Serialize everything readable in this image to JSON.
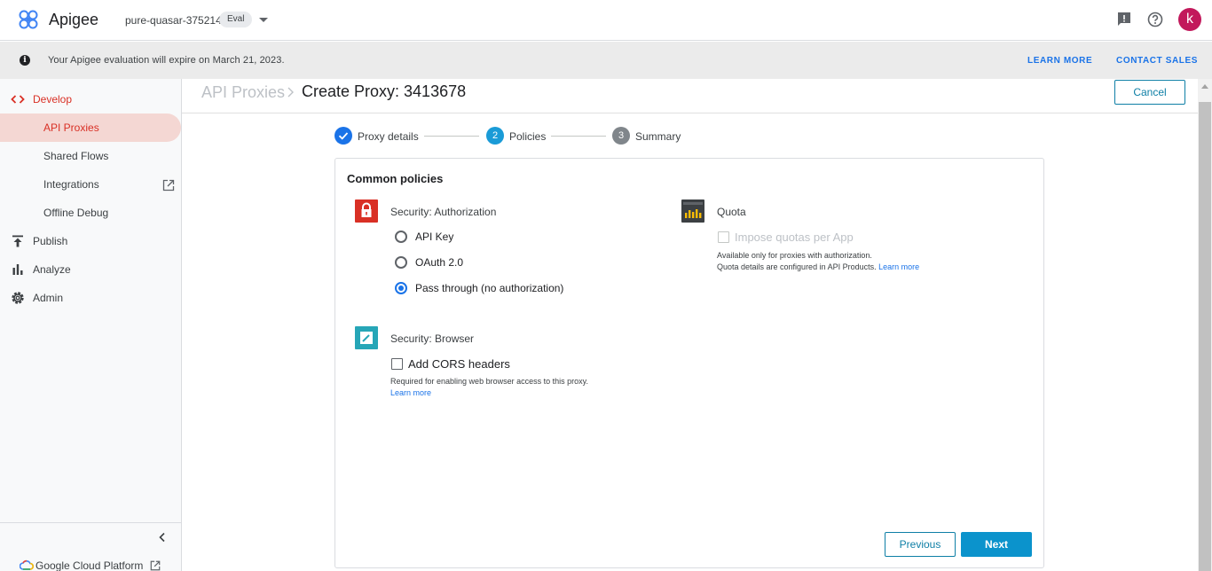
{
  "topbar": {
    "app_name": "Apigee",
    "project_name": "pure-quasar-375214",
    "project_badge": "Eval",
    "icons": [
      "apigee-logo-icon",
      "feedback-icon",
      "help-icon"
    ],
    "avatar_letter": "k",
    "avatar_color": "#c2185b"
  },
  "banner": {
    "message": "Your Apigee evaluation will expire on March 21, 2023.",
    "learn_more": "LEARN MORE",
    "contact_sales": "CONTACT SALES"
  },
  "sidebar": {
    "items": [
      {
        "label": "Develop",
        "icon": "code-icon",
        "state": "active-parent"
      },
      {
        "label": "API Proxies",
        "icon": "",
        "state": "selected"
      },
      {
        "label": "Shared Flows",
        "icon": "",
        "state": ""
      },
      {
        "label": "Integrations",
        "icon": "open-in-new-icon",
        "state": ""
      },
      {
        "label": "Offline Debug",
        "icon": "",
        "state": ""
      },
      {
        "label": "Publish",
        "icon": "publish-icon",
        "state": ""
      },
      {
        "label": "Analyze",
        "icon": "bar-chart-icon",
        "state": ""
      },
      {
        "label": "Admin",
        "icon": "gear-icon",
        "state": ""
      }
    ],
    "footer_label": "Google Cloud Platform"
  },
  "header": {
    "breadcrumb": "API Proxies",
    "title": "Create Proxy: 3413678",
    "cancel_label": "Cancel"
  },
  "stepper": {
    "steps": [
      {
        "number": "1",
        "label": "Proxy details",
        "state": "done"
      },
      {
        "number": "2",
        "label": "Policies",
        "state": "current"
      },
      {
        "number": "3",
        "label": "Summary",
        "state": "todo"
      }
    ]
  },
  "card": {
    "title": "Common policies",
    "authorization": {
      "label": "Security: Authorization",
      "options": [
        "API Key",
        "OAuth 2.0",
        "Pass through (no authorization)"
      ],
      "selected": "Pass through (no authorization)"
    },
    "quota": {
      "label": "Quota",
      "checkbox_label": "Impose quotas per App",
      "checked": false,
      "disabled": true,
      "help_line1": "Available only for proxies with authorization.",
      "help_line2": "Quota details are configured in API Products.",
      "learn_more": "Learn more"
    },
    "browser": {
      "label": "Security: Browser",
      "checkbox_label": "Add CORS headers",
      "checked": false,
      "help_line1": "Required for enabling web browser access to this proxy.",
      "learn_more": "Learn more"
    },
    "previous_label": "Previous",
    "next_label": "Next"
  },
  "colors": {
    "accent": "#1a73e8",
    "primary_button": "#0b93cc",
    "develop_red": "#d93025",
    "selected_bg": "#f4d7d3",
    "auth_icon_bg": "#d93025",
    "quota_icon_bg": "#3c4043",
    "browser_icon_bg": "#26a6b7"
  }
}
